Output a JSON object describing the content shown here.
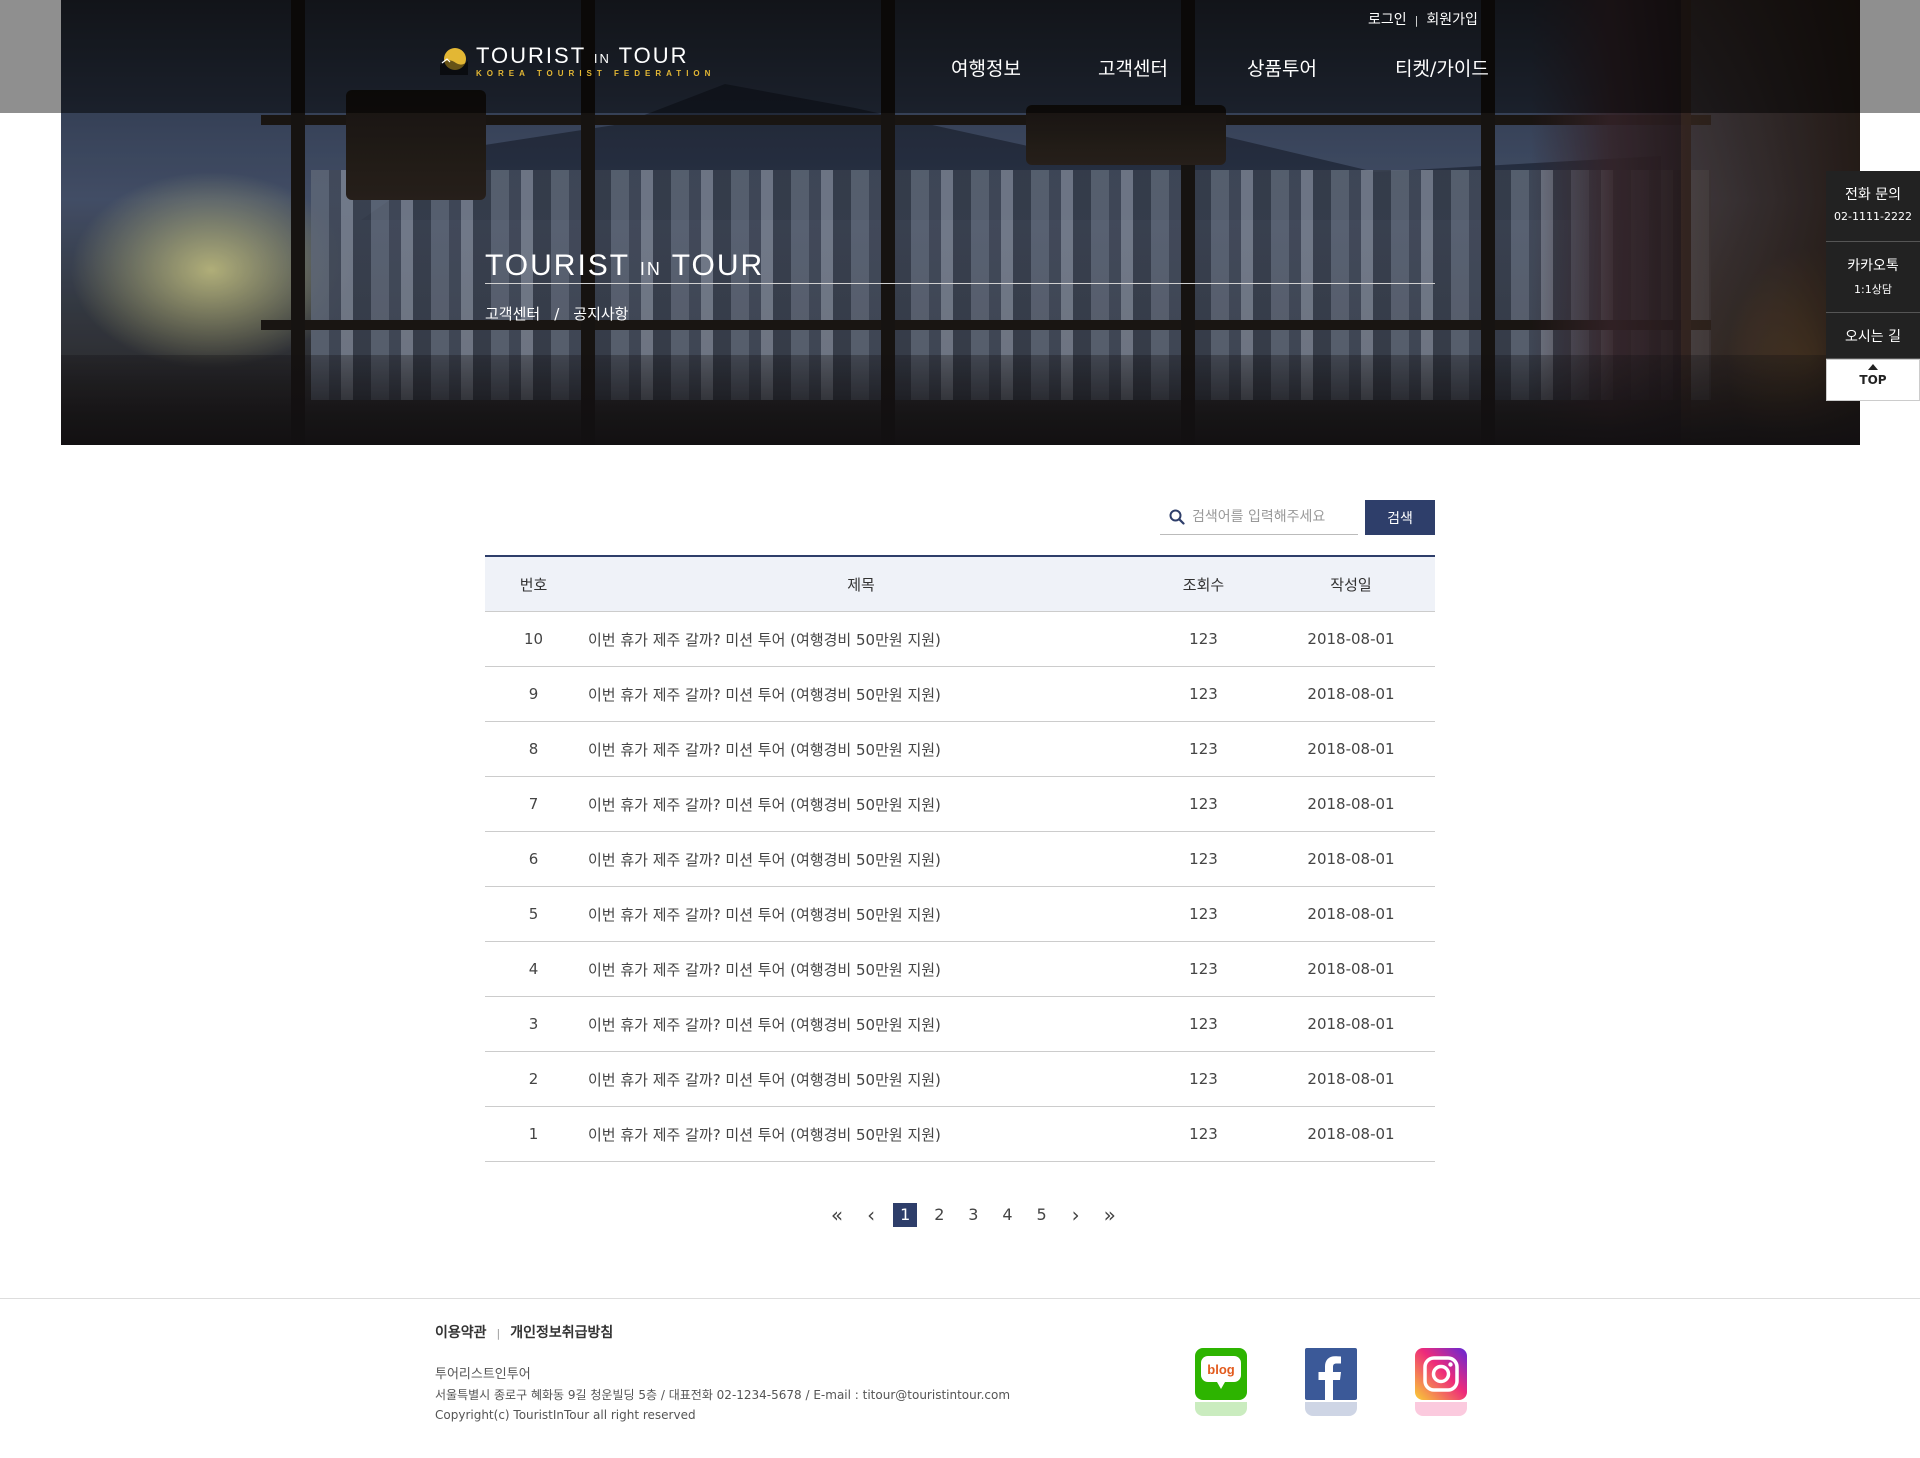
{
  "header": {
    "logo": {
      "name": "TOURIST",
      "in": "IN",
      "name2": "TOUR",
      "sub": "KOREA TOURIST FEDERATION"
    },
    "util": {
      "login": "로그인",
      "join": "회원가입"
    },
    "gnb": [
      "여행정보",
      "고객센터",
      "상품투어",
      "티켓/가이드"
    ]
  },
  "hero": {
    "title": "TOURIST",
    "title_in": "IN",
    "title2": "TOUR",
    "breadcrumb": [
      "고객센터",
      "공지사항"
    ],
    "breadcrumb_sep": "/"
  },
  "quick_menu": {
    "phone_label": "전화 문의",
    "phone_number": "02-1111-2222",
    "kakao_label": "카카오톡",
    "kakao_sub": "1:1상담",
    "directions": "오시는 길",
    "top": "TOP"
  },
  "search": {
    "placeholder": "검색어를 입력해주세요",
    "button": "검색"
  },
  "board": {
    "columns": [
      "번호",
      "제목",
      "조회수",
      "작성일"
    ],
    "rows": [
      {
        "no": "10",
        "title": "이번 휴가 제주 갈까? 미션 투어 (여행경비 50만원 지원)",
        "views": "123",
        "date": "2018-08-01"
      },
      {
        "no": "9",
        "title": "이번 휴가 제주 갈까? 미션 투어 (여행경비 50만원 지원)",
        "views": "123",
        "date": "2018-08-01"
      },
      {
        "no": "8",
        "title": "이번 휴가 제주 갈까? 미션 투어 (여행경비 50만원 지원)",
        "views": "123",
        "date": "2018-08-01"
      },
      {
        "no": "7",
        "title": "이번 휴가 제주 갈까? 미션 투어 (여행경비 50만원 지원)",
        "views": "123",
        "date": "2018-08-01"
      },
      {
        "no": "6",
        "title": "이번 휴가 제주 갈까? 미션 투어 (여행경비 50만원 지원)",
        "views": "123",
        "date": "2018-08-01"
      },
      {
        "no": "5",
        "title": "이번 휴가 제주 갈까? 미션 투어 (여행경비 50만원 지원)",
        "views": "123",
        "date": "2018-08-01"
      },
      {
        "no": "4",
        "title": "이번 휴가 제주 갈까? 미션 투어 (여행경비 50만원 지원)",
        "views": "123",
        "date": "2018-08-01"
      },
      {
        "no": "3",
        "title": "이번 휴가 제주 갈까? 미션 투어 (여행경비 50만원 지원)",
        "views": "123",
        "date": "2018-08-01"
      },
      {
        "no": "2",
        "title": "이번 휴가 제주 갈까? 미션 투어 (여행경비 50만원 지원)",
        "views": "123",
        "date": "2018-08-01"
      },
      {
        "no": "1",
        "title": "이번 휴가 제주 갈까? 미션 투어 (여행경비 50만원 지원)",
        "views": "123",
        "date": "2018-08-01"
      }
    ]
  },
  "pagination": {
    "first": "«",
    "prev": "‹",
    "pages": [
      "1",
      "2",
      "3",
      "4",
      "5"
    ],
    "current": "1",
    "next": "›",
    "last": "»"
  },
  "footer": {
    "links": [
      "이용약관",
      "개인정보취급방침"
    ],
    "company": "투어리스트인투어",
    "address": "서울특별시 종로구 혜화동 9길 청운빌딩 5층 / 대표전화 02-1234-5678 / E-mail : titour@touristintour.com",
    "copyright": "Copyright(c) TouristInTour all right reserved",
    "sns": [
      "blog-icon",
      "facebook-icon",
      "instagram-icon"
    ],
    "blog_text": "blog"
  },
  "colors": {
    "accent": "#2e3e6a",
    "logo_gold": "#e3b734",
    "header_overlay": "rgba(0,0,0,0.5)",
    "table_head_bg": "#eff2f8"
  }
}
